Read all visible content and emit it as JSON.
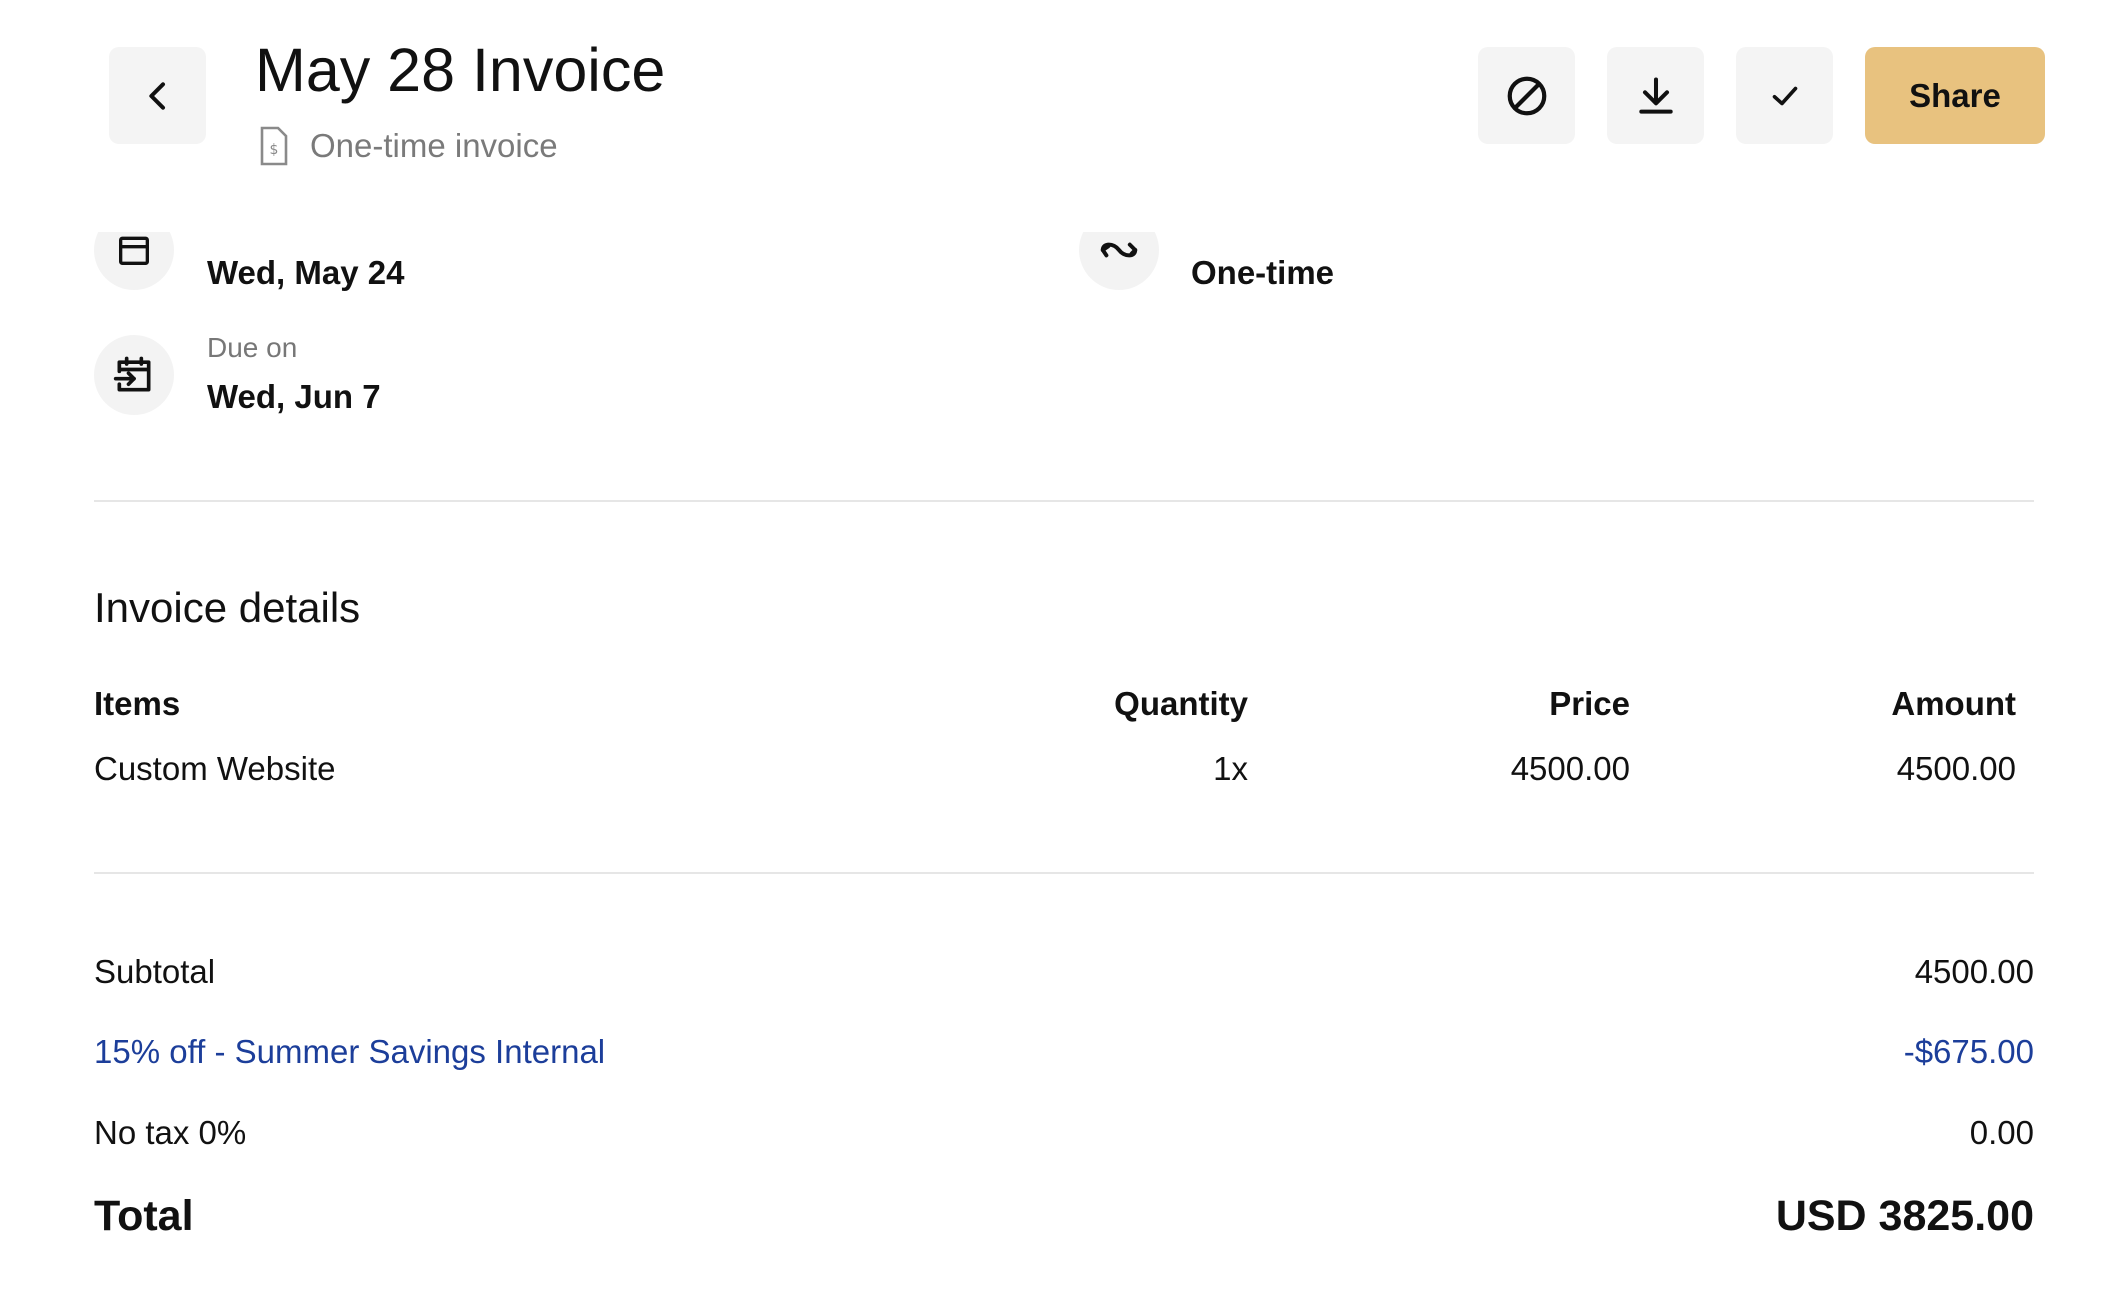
{
  "header": {
    "title": "May 28 Invoice",
    "subtitle": "One-time invoice",
    "share_label": "Share",
    "accent_color": "#e8c27f"
  },
  "meta": {
    "issued_value": "Wed, May 24",
    "frequency_value": "One-time",
    "due_label": "Due on",
    "due_value": "Wed, Jun 7"
  },
  "details": {
    "heading": "Invoice details",
    "columns": {
      "items": "Items",
      "quantity": "Quantity",
      "price": "Price",
      "amount": "Amount"
    },
    "rows": [
      {
        "item": "Custom Website",
        "quantity": "1x",
        "price": "4500.00",
        "amount": "4500.00"
      }
    ]
  },
  "summary": {
    "subtotal_label": "Subtotal",
    "subtotal_value": "4500.00",
    "discount_label": "15% off - Summer Savings Internal",
    "discount_value": "-$675.00",
    "discount_color": "#1c3e9a",
    "tax_label": "No tax 0%",
    "tax_value": "0.00",
    "total_label": "Total",
    "total_value": "USD 3825.00"
  }
}
